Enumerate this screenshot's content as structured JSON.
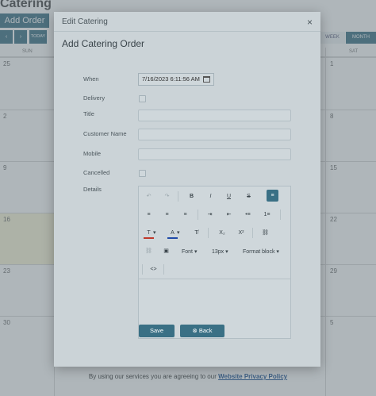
{
  "page": {
    "title": "Catering",
    "add_order_label": "Add Order",
    "nav": {
      "prev": "‹",
      "next": "›",
      "today": "TODAY"
    },
    "views": {
      "week": "WEEK",
      "month": "MONTH"
    }
  },
  "calendar": {
    "headers": {
      "sun": "SUN",
      "sat": "SAT"
    },
    "left_dates": [
      "25",
      "2",
      "9",
      "16",
      "23",
      "30"
    ],
    "right_dates": [
      "1",
      "8",
      "15",
      "22",
      "29",
      "5"
    ]
  },
  "modal": {
    "header_title": "Edit Catering",
    "close": "×",
    "form_title": "Add Catering Order",
    "fields": {
      "when_label": "When",
      "when_value": "7/16/2023 6:11:56 AM",
      "delivery_label": "Delivery",
      "title_label": "Title",
      "customer_name_label": "Customer Name",
      "mobile_label": "Mobile",
      "cancelled_label": "Cancelled",
      "details_label": "Details"
    },
    "editor": {
      "undo": "↶",
      "redo": "↷",
      "bold": "B",
      "italic": "I",
      "underline": "U",
      "strike": "S",
      "align_left": "≡",
      "align_center": "≡",
      "align_right": "≡",
      "justify": "≡",
      "indent": "⇥",
      "outdent": "⇤",
      "bullets": "•≡",
      "numbers": "1≡",
      "text_color": "T",
      "highlight": "A",
      "clear_format": "T̸",
      "subscript": "X₂",
      "superscript": "X²",
      "link": "⛓",
      "unlink": "⛓",
      "image": "▣",
      "font": "Font",
      "font_size": "13px",
      "format_block": "Format block",
      "code": "<>"
    },
    "buttons": {
      "save": "Save",
      "back": "Back",
      "back_icon": "⊗"
    }
  },
  "footer": {
    "text": "By using our services you are agreeing to our ",
    "link": "Website Privacy Policy"
  }
}
